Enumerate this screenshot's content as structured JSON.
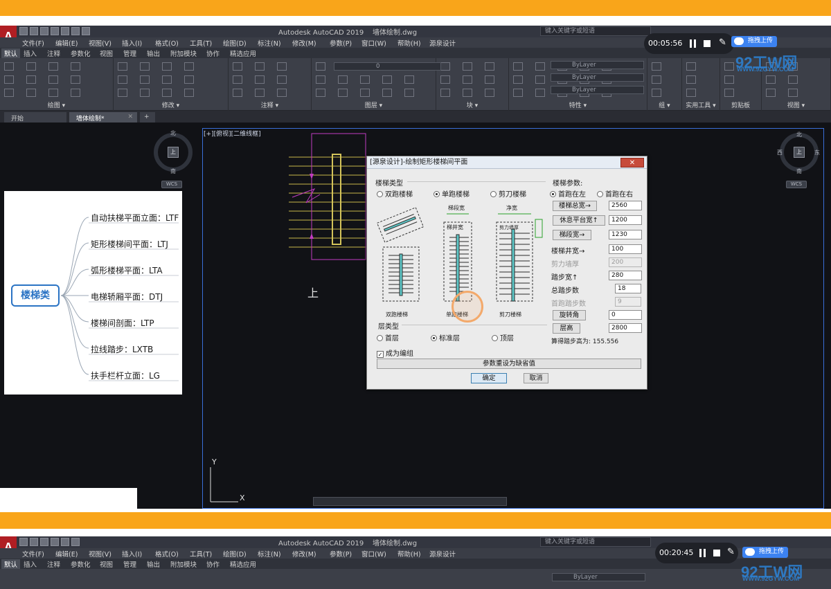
{
  "app": {
    "title": "Autodesk AutoCAD 2019",
    "file": "墙体绘制.dwg",
    "search_placeholder": "键入关键字或短语",
    "logo": "A"
  },
  "menu": [
    "文件(F)",
    "编辑(E)",
    "视图(V)",
    "插入(I)",
    "格式(O)",
    "工具(T)",
    "绘图(D)",
    "标注(N)",
    "修改(M)",
    "参数(P)",
    "窗口(W)",
    "帮助(H)",
    "源泉设计"
  ],
  "ribbon_tabs": [
    "默认",
    "插入",
    "注释",
    "参数化",
    "视图",
    "管理",
    "输出",
    "附加模块",
    "协作",
    "精选应用"
  ],
  "ribbon_panels": [
    "绘图 ▾",
    "修改 ▾",
    "注释 ▾",
    "图层 ▾",
    "块 ▾",
    "特性 ▾",
    "组 ▾",
    "实用工具 ▾",
    "剪贴板",
    "视图 ▾"
  ],
  "ribbon": {
    "bylayer": [
      "ByLayer",
      "ByLayer",
      "ByLayer"
    ],
    "layer_value": "0"
  },
  "doc_tabs": [
    "开始",
    "墙体绘制*",
    "+"
  ],
  "viewport_label": "[+][俯视][二维线框]",
  "compass": {
    "north": "北",
    "south": "南",
    "west": "西",
    "east": "东",
    "cube": "上",
    "wcs": "WCS"
  },
  "mindmap": {
    "root": "楼梯类",
    "items": [
      "自动扶梯平面立面：LTF",
      "矩形楼梯间平面：LTJ",
      "弧形楼梯平面：LTA",
      "电梯轿厢平面：DTJ",
      "楼梯间剖面：LTP",
      "拉线踏步：LXTB",
      "扶手栏杆立面：LG"
    ]
  },
  "drawing": {
    "label_up": "上"
  },
  "ucs": {
    "x": "X",
    "y": "Y"
  },
  "dialog": {
    "title": "[源泉设计]-绘制矩形楼梯间平面",
    "close": "✕",
    "stair_type_label": "楼梯类型",
    "stair_types": [
      {
        "label": "双跑楼梯",
        "selected": false
      },
      {
        "label": "单跑楼梯",
        "selected": true
      },
      {
        "label": "剪刀楼梯",
        "selected": false
      }
    ],
    "preview_labels": {
      "double": "双跑楼梯",
      "single": "单跑楼梯",
      "scissor": "剪刀楼梯",
      "run_width": "梯段宽",
      "net_width": "净宽",
      "well_width": "梯井宽",
      "wall_thick": "剪力墙厚",
      "total_width": "楼梯总宽",
      "platform": "休息平台宽"
    },
    "floor_type_label": "层类型",
    "floor_types": [
      {
        "label": "首层",
        "selected": false
      },
      {
        "label": "标准层",
        "selected": true
      },
      {
        "label": "顶层",
        "selected": false
      }
    ],
    "group_label": "成为编组",
    "group_checked": true,
    "reset_button": "参数重设为缺省值",
    "ok_button": "确定",
    "cancel_button": "取消",
    "params_label": "楼梯参数:",
    "first_run": [
      {
        "label": "首跑在左",
        "selected": true
      },
      {
        "label": "首跑在右",
        "selected": false
      }
    ],
    "params": [
      {
        "label": "楼梯总宽→",
        "value": "2560",
        "button": true,
        "disabled": false
      },
      {
        "label": "休息平台宽↑",
        "value": "1200",
        "button": true,
        "disabled": false
      },
      {
        "label": "梯段宽→",
        "value": "1230",
        "button": true,
        "disabled": false
      },
      {
        "label": "楼梯井宽→",
        "value": "100",
        "button": false,
        "disabled": false
      },
      {
        "label": "剪力墙厚",
        "value": "200",
        "button": false,
        "disabled": true
      },
      {
        "label": "踏步宽↑",
        "value": "280",
        "button": false,
        "disabled": false
      },
      {
        "label": "总踏步数",
        "value": "18",
        "button": false,
        "disabled": false
      },
      {
        "label": "首跑踏步数",
        "value": "9",
        "button": false,
        "disabled": true
      },
      {
        "label": "旋转角",
        "value": "0",
        "button": true,
        "disabled": false
      },
      {
        "label": "层高",
        "value": "2800",
        "button": true,
        "disabled": false
      }
    ],
    "computed": "算得踏步高为: 155.556"
  },
  "recorder_top": {
    "time": "00:05:56",
    "upload": "拖拽上传"
  },
  "recorder_bottom": {
    "time": "00:20:45",
    "upload": "拖拽上传"
  },
  "watermark": {
    "brand": "92工W网",
    "url": "WWW.92GYW.COM"
  },
  "colors": {
    "accent_band": "#f9a51a",
    "cad_bg": "#111216",
    "selection": "#3a6fd8"
  }
}
